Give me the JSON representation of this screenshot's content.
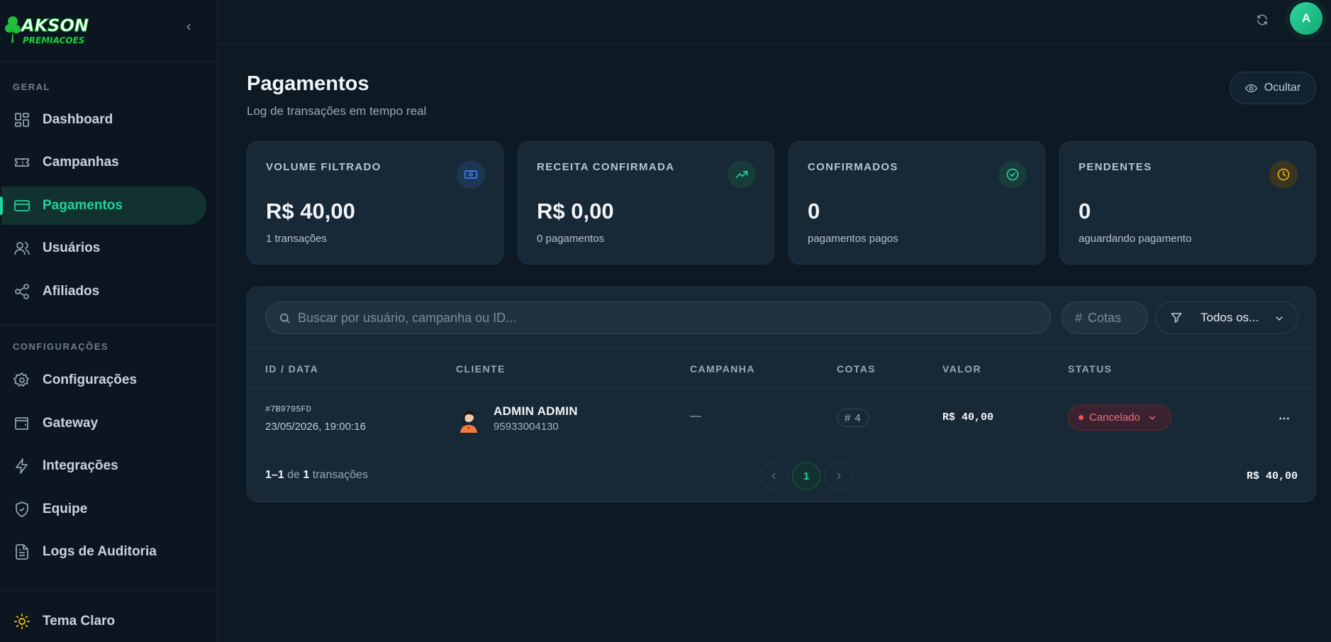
{
  "brand": {
    "logo_top": "AKSON",
    "logo_bottom": "PREMIACOES"
  },
  "nav": {
    "section_general": "GERAL",
    "section_config": "CONFIGURAÇÕES",
    "items": [
      {
        "label": "Dashboard",
        "icon": "dashboard-icon"
      },
      {
        "label": "Campanhas",
        "icon": "ticket-icon"
      },
      {
        "label": "Pagamentos",
        "icon": "credit-card-icon",
        "active": true
      },
      {
        "label": "Usuários",
        "icon": "users-icon"
      },
      {
        "label": "Afiliados",
        "icon": "share-icon"
      }
    ],
    "config_items": [
      {
        "label": "Configurações",
        "icon": "gear-icon"
      },
      {
        "label": "Gateway",
        "icon": "wallet-icon"
      },
      {
        "label": "Integrações",
        "icon": "lightning-icon"
      },
      {
        "label": "Equipe",
        "icon": "shield-icon"
      },
      {
        "label": "Logs de Auditoria",
        "icon": "document-icon"
      }
    ],
    "theme_label": "Tema Claro"
  },
  "topbar": {
    "avatar_initial": "A"
  },
  "header": {
    "title": "Pagamentos",
    "subtitle": "Log de transações em tempo real",
    "hide_label": "Ocultar"
  },
  "cards": [
    {
      "label": "VOLUME FILTRADO",
      "value": "R$ 40,00",
      "sub": "1 transações",
      "icon": "cash-icon",
      "color": "#3b82f6"
    },
    {
      "label": "RECEITA CONFIRMADA",
      "value": "R$ 0,00",
      "sub": "0 pagamentos",
      "icon": "trending-up-icon",
      "color": "#22d39a"
    },
    {
      "label": "CONFIRMADOS",
      "value": "0",
      "sub": "pagamentos pagos",
      "icon": "check-circle-icon",
      "color": "#22d39a"
    },
    {
      "label": "PENDENTES",
      "value": "0",
      "sub": "aguardando pagamento",
      "icon": "clock-icon",
      "color": "#eab308"
    }
  ],
  "filters": {
    "search_placeholder": "Buscar por usuário, campanha ou ID...",
    "cotas_placeholder": "Cotas",
    "cotas_hash": "#",
    "status_label": "Todos os..."
  },
  "table": {
    "columns": [
      "ID / DATA",
      "CLIENTE",
      "CAMPANHA",
      "COTAS",
      "VALOR",
      "STATUS"
    ],
    "rows": [
      {
        "id": "#7B9795FD",
        "date": "23/05/2026, 19:00:16",
        "name": "ADMIN ADMIN",
        "phone": "95933004130",
        "campaign": "—",
        "cotas_hash": "#",
        "cotas": "4",
        "valor": "R$ 40,00",
        "status": "Cancelado"
      }
    ]
  },
  "footer": {
    "range": "1–1",
    "of": "de",
    "total_count": "1",
    "suffix": "transações",
    "page": "1",
    "total_value": "R$ 40,00"
  }
}
